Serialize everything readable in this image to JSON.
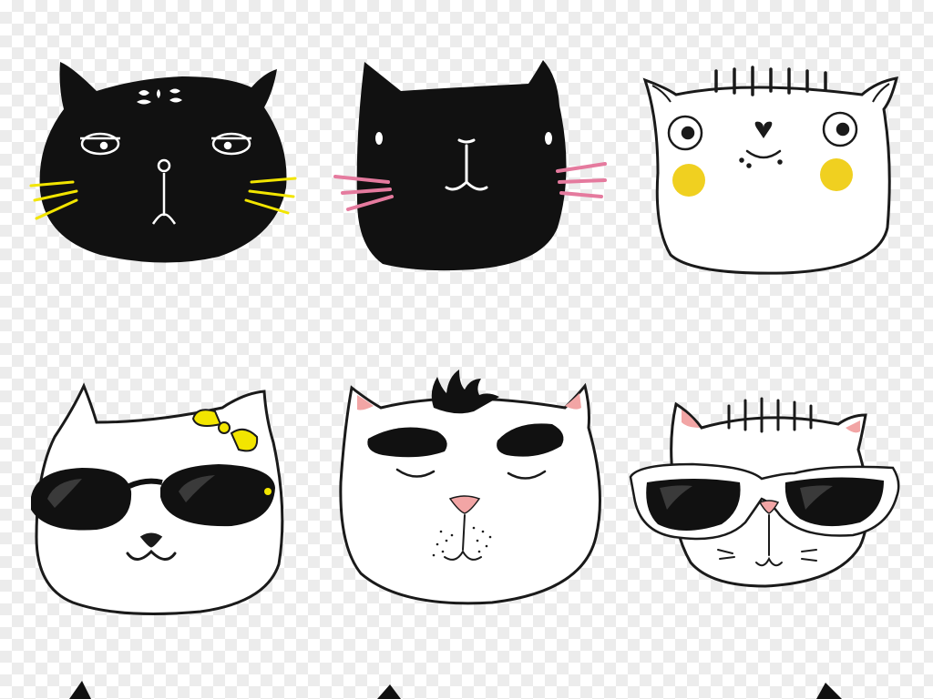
{
  "illustration": {
    "background": "transparency-checkerboard",
    "colors": {
      "ink": "#111111",
      "outline": "#1a1a1a",
      "white": "#ffffff",
      "yellow": "#f2e500",
      "cheek_yellow": "#f0d020",
      "pink": "#e57a9e",
      "nose_pink": "#f2a5a5",
      "lens_shine": "#3a3a3a"
    },
    "cats": [
      {
        "name": "black-cat-grumpy",
        "row": 1,
        "col": 1,
        "features": [
          "striped-forehead",
          "half-closed-eyes",
          "yellow-whiskers"
        ]
      },
      {
        "name": "black-cat-smiling",
        "row": 1,
        "col": 2,
        "features": [
          "dot-eyes",
          "pink-whiskers"
        ]
      },
      {
        "name": "white-cat-yellow-cheeks",
        "row": 1,
        "col": 3,
        "features": [
          "striped-forehead",
          "round-eyes",
          "heart-nose",
          "yellow-cheeks"
        ]
      },
      {
        "name": "white-cat-bow-sunglasses",
        "row": 2,
        "col": 1,
        "features": [
          "yellow-bow",
          "black-sunglasses",
          "smile"
        ]
      },
      {
        "name": "white-cat-eyebrows",
        "row": 2,
        "col": 2,
        "features": [
          "tuft",
          "bushy-eyebrows",
          "closed-eyes",
          "pink-nose"
        ]
      },
      {
        "name": "white-cat-striped-sunglasses",
        "row": 2,
        "col": 3,
        "features": [
          "striped-forehead",
          "white-frame-sunglasses",
          "pink-nose"
        ]
      }
    ],
    "partial_row": [
      "ear-tip-left",
      "ear-tip-center",
      "ear-tip-right"
    ]
  }
}
